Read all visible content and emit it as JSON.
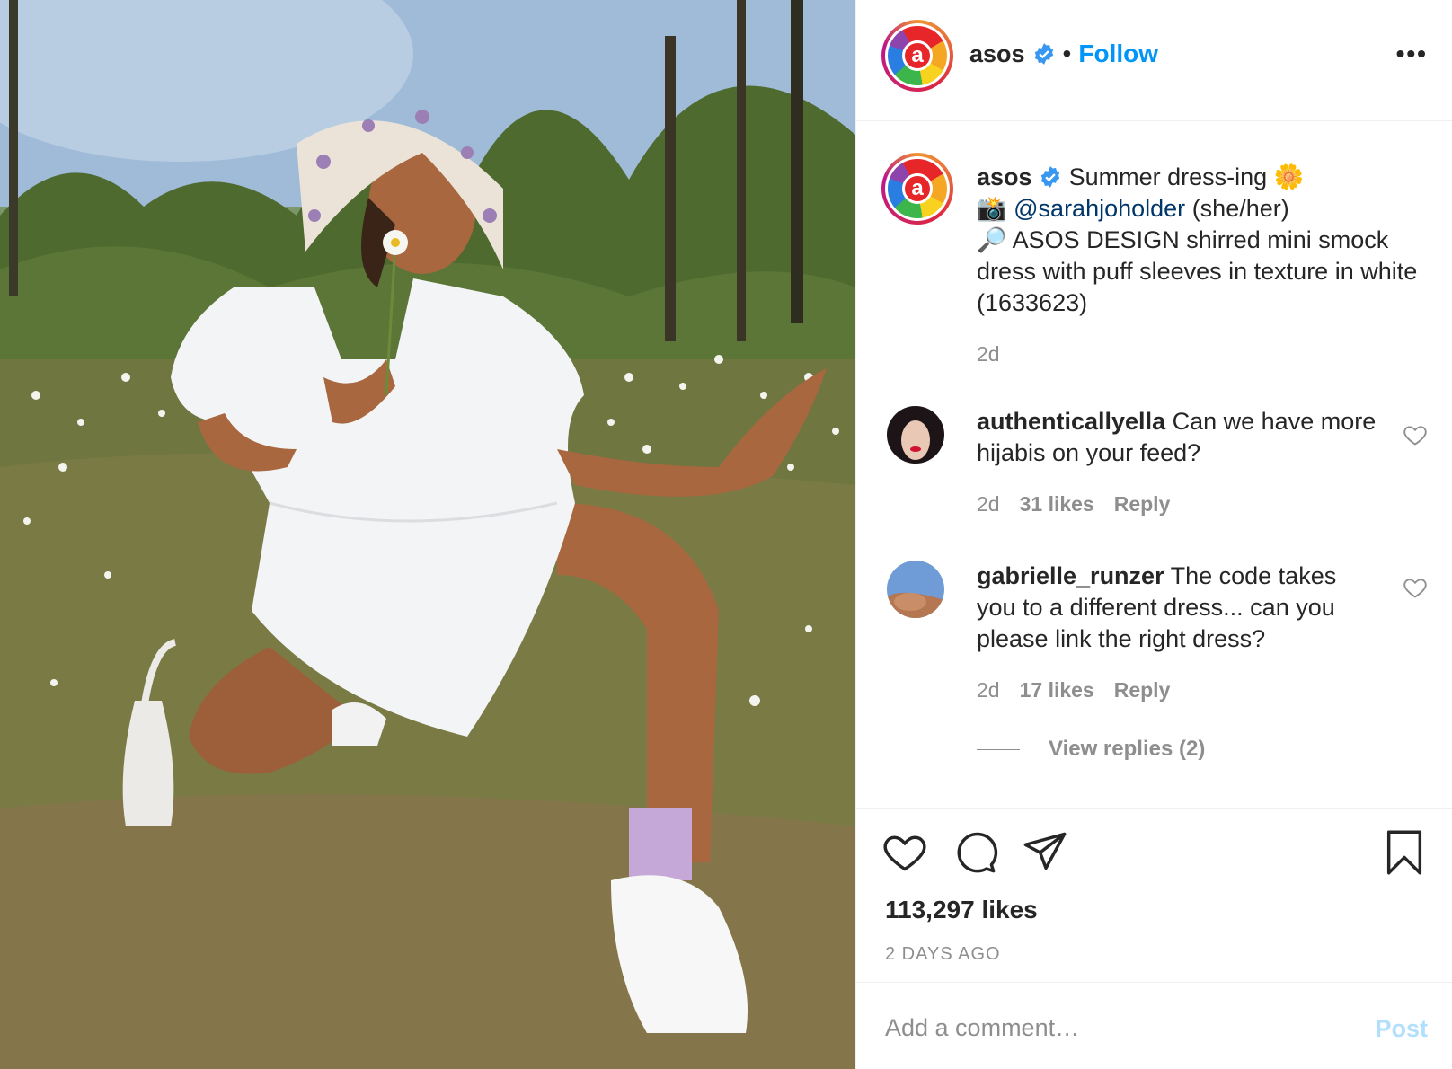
{
  "post": {
    "image_alt": "Woman in white smock dress and floral bucket hat crouching in a meadow of daisies"
  },
  "header": {
    "username": "asos",
    "separator": "•",
    "follow_label": "Follow",
    "more_icon": "more-horizontal-icon",
    "more_label": "•••"
  },
  "caption": {
    "username": "asos",
    "line1": "Summer dress-ing",
    "sun_emoji": "🌼",
    "camera_emoji": "📸",
    "mention": "@sarahjoholder",
    "pronouns": "(she/her)",
    "search_emoji": "🔎",
    "product": "ASOS DESIGN shirred mini smock dress with puff sleeves in texture in white (1633623)",
    "time": "2d"
  },
  "comments": [
    {
      "username": "authenticallyella",
      "text": "Can we have more hijabis on your feed?",
      "time": "2d",
      "likes": "31 likes",
      "reply_label": "Reply"
    },
    {
      "username": "gabrielle_runzer",
      "text": "The code takes you to a different dress... can you please link the right dress?",
      "time": "2d",
      "likes": "17 likes",
      "reply_label": "Reply",
      "view_replies": "View replies (2)"
    }
  ],
  "actions": {
    "likes": "113,297 likes",
    "time_ago": "2 DAYS AGO"
  },
  "add_comment": {
    "placeholder": "Add a comment…",
    "post_label": "Post"
  },
  "colors": {
    "follow_blue": "#0095f6",
    "mention_blue": "#00376b",
    "muted_gray": "#8e8e8e",
    "post_disabled": "#b2dffc",
    "verified_blue": "#3897f0"
  }
}
